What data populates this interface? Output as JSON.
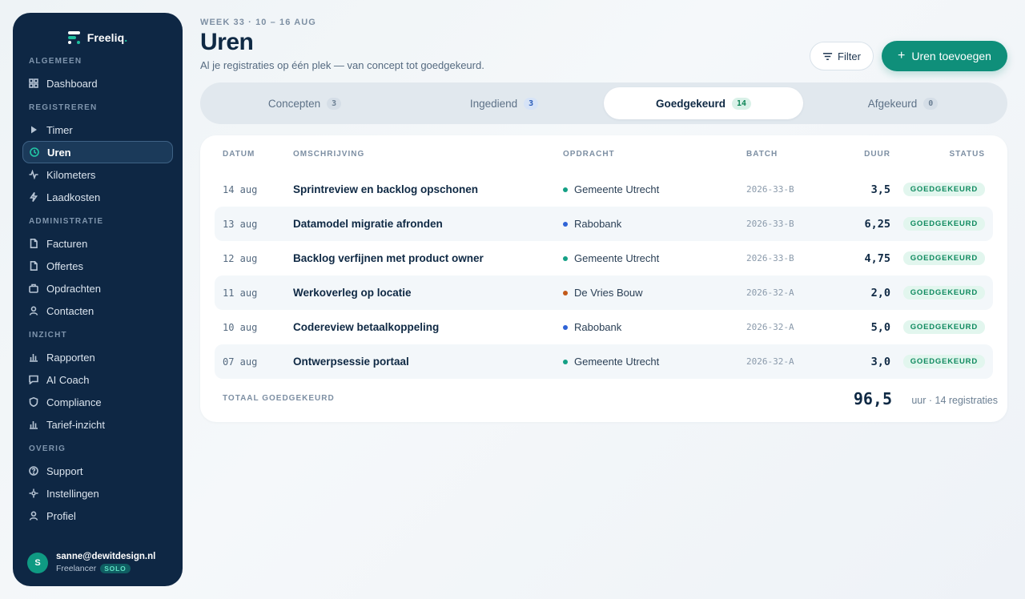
{
  "app": {
    "name": "Freeliq"
  },
  "colors": {
    "sidebar_bg": "#0e2744",
    "accent": "#0f8f7a",
    "active_icon": "#22c7a6"
  },
  "sidebar": {
    "sections": [
      {
        "title": "ALGEMEEN",
        "items": [
          {
            "label": "Dashboard",
            "icon": "grid-icon"
          }
        ]
      },
      {
        "title": "REGISTREREN",
        "items": [
          {
            "label": "Timer",
            "icon": "play-icon"
          },
          {
            "label": "Uren",
            "icon": "clock-icon",
            "active": true
          },
          {
            "label": "Kilometers",
            "icon": "activity-icon"
          },
          {
            "label": "Laadkosten",
            "icon": "bolt-icon"
          }
        ]
      },
      {
        "title": "ADMINISTRATIE",
        "items": [
          {
            "label": "Facturen",
            "icon": "document-icon"
          },
          {
            "label": "Offertes",
            "icon": "document-icon"
          },
          {
            "label": "Opdrachten",
            "icon": "briefcase-icon"
          },
          {
            "label": "Contacten",
            "icon": "user-icon"
          }
        ]
      },
      {
        "title": "INZICHT",
        "items": [
          {
            "label": "Rapporten",
            "icon": "bar-chart-icon"
          },
          {
            "label": "AI Coach",
            "icon": "chat-icon"
          },
          {
            "label": "Compliance",
            "icon": "shield-icon"
          },
          {
            "label": "Tarief-inzicht",
            "icon": "bar-chart-icon"
          }
        ]
      },
      {
        "title": "OVERIG",
        "items": [
          {
            "label": "Support",
            "icon": "help-icon"
          },
          {
            "label": "Instellingen",
            "icon": "settings-icon"
          },
          {
            "label": "Profiel",
            "icon": "user-icon"
          }
        ]
      }
    ],
    "user": {
      "initial": "S",
      "email": "sanne@dewitdesign.nl",
      "role": "Freelancer",
      "plan": "SOLO"
    }
  },
  "header": {
    "eyebrow": "WEEK 33 · 10 – 16 AUG",
    "title": "Uren",
    "subtitle": "Al je registraties op één plek — van concept tot goedgekeurd.",
    "filter_label": "Filter",
    "add_label": "Uren toevoegen"
  },
  "tabs": [
    {
      "label": "Concepten",
      "count": "3",
      "style": "gray"
    },
    {
      "label": "Ingediend",
      "count": "3",
      "style": "blue"
    },
    {
      "label": "Goedgekeurd",
      "count": "14",
      "style": "green",
      "active": true
    },
    {
      "label": "Afgekeurd",
      "count": "0",
      "style": "gray"
    }
  ],
  "table": {
    "columns": {
      "date": "DATUM",
      "desc": "OMSCHRIJVING",
      "client": "OPDRACHT",
      "batch": "BATCH",
      "duration": "DUUR",
      "status": "STATUS"
    },
    "rows": [
      {
        "date": "14 aug",
        "desc": "Sprintreview en backlog opschonen",
        "client": "Gemeente Utrecht",
        "client_color": "#14a085",
        "batch": "2026-33-B",
        "duration": "3,5",
        "status": "GOEDGEKEURD"
      },
      {
        "date": "13 aug",
        "desc": "Datamodel migratie afronden",
        "client": "Rabobank",
        "client_color": "#2f63d6",
        "batch": "2026-33-B",
        "duration": "6,25",
        "status": "GOEDGEKEURD"
      },
      {
        "date": "12 aug",
        "desc": "Backlog verfijnen met product owner",
        "client": "Gemeente Utrecht",
        "client_color": "#14a085",
        "batch": "2026-33-B",
        "duration": "4,75",
        "status": "GOEDGEKEURD"
      },
      {
        "date": "11 aug",
        "desc": "Werkoverleg op locatie",
        "client": "De Vries Bouw",
        "client_color": "#c2591a",
        "batch": "2026-32-A",
        "duration": "2,0",
        "status": "GOEDGEKEURD"
      },
      {
        "date": "10 aug",
        "desc": "Codereview betaalkoppeling",
        "client": "Rabobank",
        "client_color": "#2f63d6",
        "batch": "2026-32-A",
        "duration": "5,0",
        "status": "GOEDGEKEURD"
      },
      {
        "date": "07 aug",
        "desc": "Ontwerpsessie portaal",
        "client": "Gemeente Utrecht",
        "client_color": "#14a085",
        "batch": "2026-32-A",
        "duration": "3,0",
        "status": "GOEDGEKEURD"
      }
    ],
    "total": {
      "label": "TOTAAL GOEDGEKEURD",
      "value": "96,5",
      "unit": "uur · 14 registraties"
    }
  }
}
